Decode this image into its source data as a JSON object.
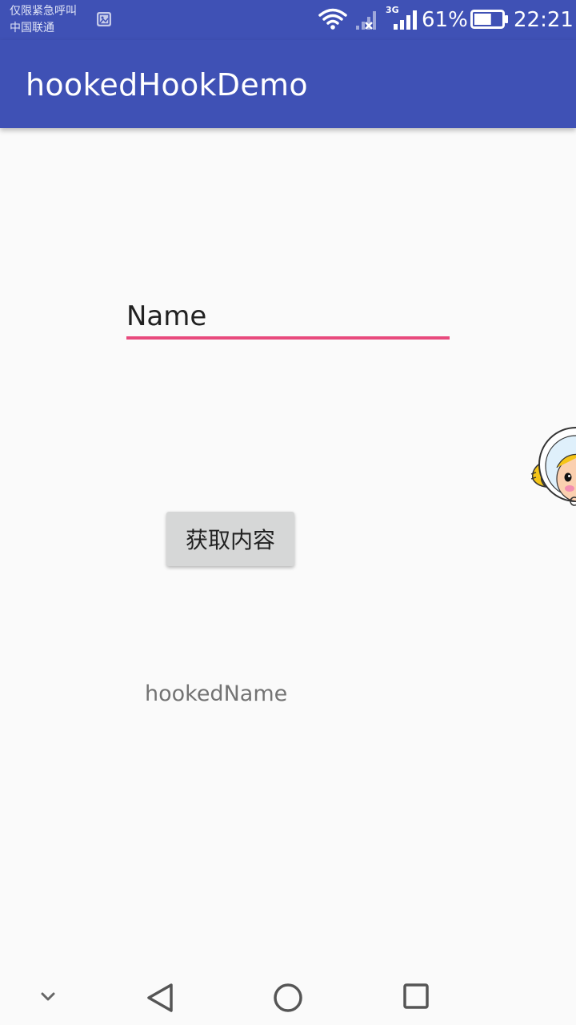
{
  "status_bar": {
    "carrier_line1": "仅限紧急呼叫",
    "carrier_line2": "中国联通",
    "network_type": "3G",
    "battery_percent": "61%",
    "battery_level": 0.61,
    "time": "22:21",
    "icons": [
      "gallery-notification-icon",
      "wifi-icon",
      "signal-no-service-icon",
      "signal-3g-icon",
      "battery-icon"
    ]
  },
  "app_bar": {
    "title": "hookedHookDemo",
    "color": "#3f51b5"
  },
  "form": {
    "name_placeholder": "Name",
    "name_value": "",
    "underline_color": "#e84a7d",
    "button_label": "获取内容"
  },
  "result": {
    "text": "hookedName"
  },
  "nav_bar": {
    "icons": [
      "chevron-down-icon",
      "back-icon",
      "home-icon",
      "recents-icon"
    ]
  }
}
